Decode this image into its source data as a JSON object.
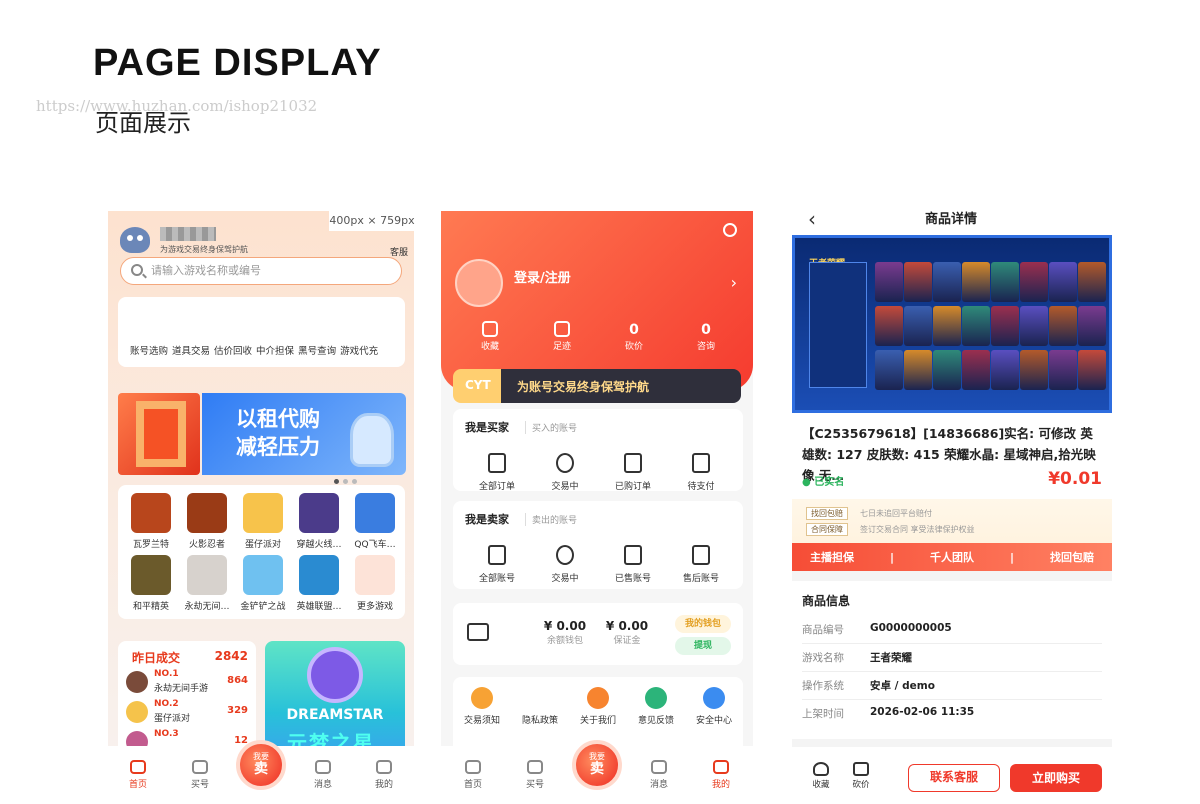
{
  "page": {
    "title": "PAGE DISPLAY",
    "subtitle": "页面展示",
    "watermark": "https://www.huzhan.com/ishop21032",
    "dimension": "400px × 759px"
  },
  "colors": {
    "accent": "#f0392b",
    "orange": "#ff7a52",
    "blue": "#2f7cf4"
  },
  "home": {
    "tagline": "为游戏交易终身保驾护航",
    "service": "客服",
    "search_placeholder": "请输入游戏名称或编号",
    "categories": [
      "账号选购",
      "道具交易",
      "估价回收",
      "中介担保",
      "黑号查询",
      "游戏代充"
    ],
    "banner_text": [
      "以租代购",
      "减轻压力"
    ],
    "games": [
      {
        "name": "瓦罗兰特",
        "color": "#b8461c"
      },
      {
        "name": "火影忍者",
        "color": "#9a3b16"
      },
      {
        "name": "蛋仔派对",
        "color": "#f7c34b"
      },
      {
        "name": "穿越火线…",
        "color": "#4b3b8a"
      },
      {
        "name": "QQ飞车…",
        "color": "#3a7de0"
      },
      {
        "name": "和平精英",
        "color": "#6b5a2b"
      },
      {
        "name": "永劫无间…",
        "color": "#d7d2cd"
      },
      {
        "name": "金铲铲之战",
        "color": "#6fc1f0"
      },
      {
        "name": "英雄联盟…",
        "color": "#2a8bd1"
      },
      {
        "name": "更多游戏",
        "color": "#fde3d8"
      }
    ],
    "yesterday": {
      "title": "昨日成交",
      "count": "2842",
      "rows": [
        {
          "rank": "NO.1",
          "name": "永劫无间手游",
          "value": "864",
          "color": "#7a4b3a"
        },
        {
          "rank": "NO.2",
          "name": "蛋仔派对",
          "value": "329",
          "color": "#f5c34b"
        },
        {
          "rank": "NO.3",
          "name": "",
          "value": "12",
          "color": "#c25b8e"
        }
      ]
    },
    "dream": {
      "title": "DREAMSTAR",
      "cn": "元梦之星"
    },
    "tabs": [
      "首页",
      "买号",
      "消息",
      "我的"
    ],
    "sell": {
      "top": "我要",
      "main": "卖"
    }
  },
  "mine": {
    "login": "登录/注册",
    "stats": [
      {
        "num": "",
        "label": "收藏"
      },
      {
        "num": "",
        "label": "足迹"
      },
      {
        "num": "0",
        "label": "砍价"
      },
      {
        "num": "0",
        "label": "咨询"
      }
    ],
    "guard": {
      "cyt": "CYT",
      "text": "为账号交易终身保驾护航"
    },
    "buyer": {
      "title": "我是买家",
      "sub": "买入的账号",
      "items": [
        "全部订单",
        "交易中",
        "已购订单",
        "待支付"
      ]
    },
    "seller": {
      "title": "我是卖家",
      "sub": "卖出的账号",
      "items": [
        "全部账号",
        "交易中",
        "已售账号",
        "售后账号"
      ]
    },
    "wallet": {
      "balance": "¥ 0.00",
      "balance_label": "余额钱包",
      "deposit": "¥ 0.00",
      "deposit_label": "保证金",
      "my_wallet": "我的钱包",
      "withdraw": "提现"
    },
    "tools": [
      {
        "label": "交易须知",
        "color": "#f7a234"
      },
      {
        "label": "隐私政策",
        "color": "#ffffff"
      },
      {
        "label": "关于我们",
        "color": "#f7842f"
      },
      {
        "label": "意见反馈",
        "color": "#2cb47a"
      },
      {
        "label": "安全中心",
        "color": "#3b8cf0"
      }
    ],
    "tabs": [
      "首页",
      "买号",
      "消息",
      "我的"
    ]
  },
  "detail": {
    "title": "商品详情",
    "game_banner": "王者荣耀",
    "name": "【C2535679618】[14836686]实名: 可修改 英雄数: 127 皮肤数: 415 荣耀水晶: 星域神启,拾光映像 无…",
    "verified": "已实名",
    "price": "¥0.01",
    "service_rows": [
      {
        "label": "找回包赔",
        "desc": "七日未追回平台赔付"
      },
      {
        "label": "合同保障",
        "desc": "签订交易合同 享受法律保护权益"
      }
    ],
    "service_bar": [
      "主播担保",
      "|",
      "千人团队",
      "|",
      "找回包赔"
    ],
    "info_title": "商品信息",
    "info": [
      {
        "k": "商品编号",
        "v": "G0000000005"
      },
      {
        "k": "游戏名称",
        "v": "王者荣耀"
      },
      {
        "k": "操作系统",
        "v": "安卓 / demo"
      },
      {
        "k": "上架时间",
        "v": "2026-02-06 11:35"
      }
    ],
    "bottom": {
      "fav": "收藏",
      "bargain": "砍价",
      "contact": "联系客服",
      "buy": "立即购买"
    }
  }
}
